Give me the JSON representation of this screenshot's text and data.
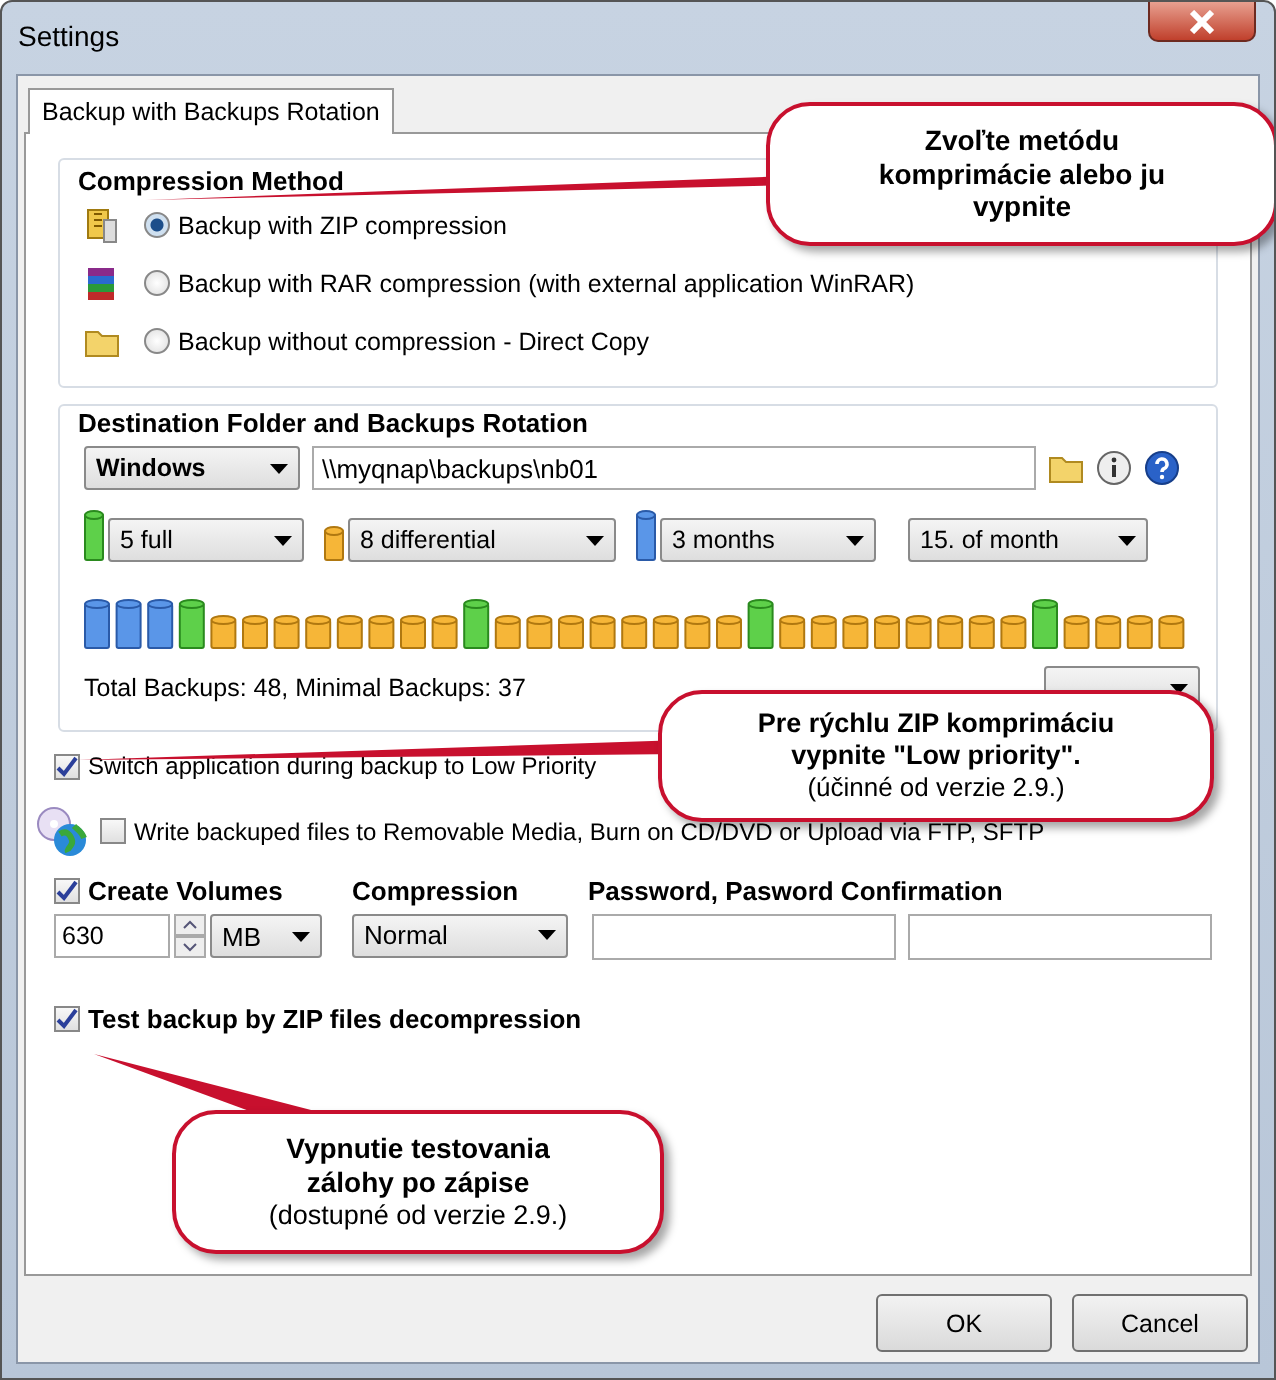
{
  "window": {
    "title": "Settings"
  },
  "tabs": [
    {
      "label": "Backup with Backups Rotation",
      "selected": true
    }
  ],
  "compression_method": {
    "title": "Compression Method",
    "options": [
      {
        "label": "Backup with ZIP compression",
        "kind": "zip",
        "selected": true
      },
      {
        "label": "Backup with RAR compression (with external application WinRAR)",
        "kind": "rar",
        "selected": false
      },
      {
        "label": "Backup without compression - Direct Copy",
        "kind": "folder",
        "selected": false
      }
    ]
  },
  "destination": {
    "title": "Destination Folder and Backups Rotation",
    "system": "Windows",
    "path": "\\\\myqnap\\backups\\nb01",
    "rotation": [
      {
        "kind": "full",
        "value": "5 full"
      },
      {
        "kind": "diff",
        "value": "8 differential"
      },
      {
        "kind": "monthly",
        "value": "3 months"
      },
      {
        "kind": "none",
        "value": "15. of month"
      }
    ],
    "totals": "Total Backups: 48, Minimal Backups: 37"
  },
  "low_priority": {
    "label": "Switch application during backup to Low Priority",
    "checked": true
  },
  "removable": {
    "label": "Write backuped files to Removable Media, Burn on CD/DVD or Upload via FTP, SFTP",
    "checked": false
  },
  "volumes": {
    "label": "Create Volumes",
    "checked": true,
    "size": "630",
    "unit": "MB"
  },
  "compression": {
    "label": "Compression",
    "value": "Normal"
  },
  "password": {
    "label": "Password, Pasword Confirmation"
  },
  "test": {
    "label": "Test backup by ZIP files decompression",
    "checked": true
  },
  "buttons": [
    "OK",
    "Cancel"
  ],
  "callouts": [
    {
      "title": "Zvoľte metódu komprimácie alebo ju vypnite"
    },
    {
      "title": "Pre rýchlu ZIP komprimáciu vypnite \"Low priority\".",
      "note": "(účinné od verzie 2.9.)"
    },
    {
      "title": "Vypnutie testovania zálohy po zápise",
      "note": "(dostupné od verzie 2.9.)"
    }
  ]
}
